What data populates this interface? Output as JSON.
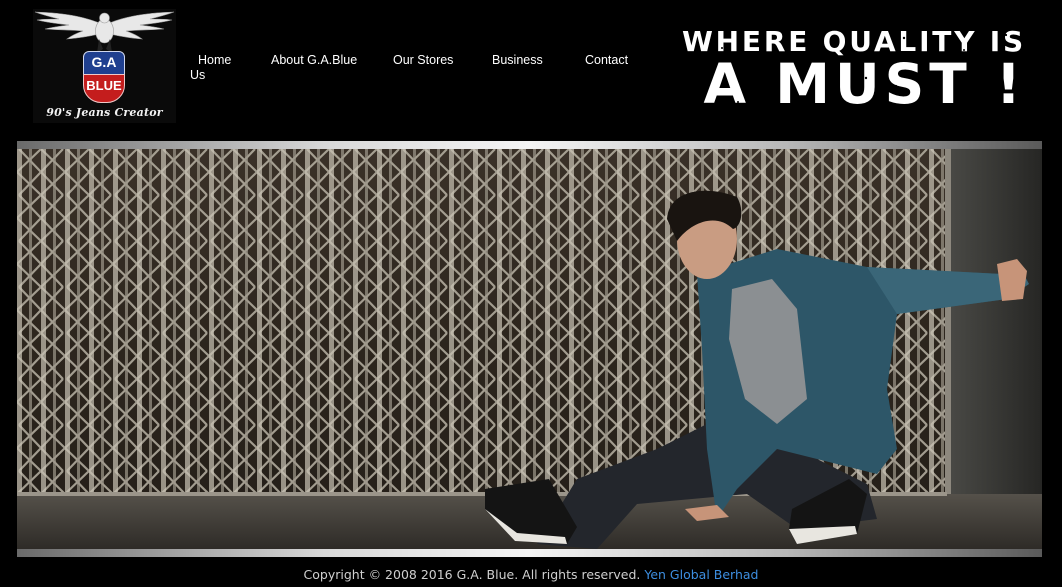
{
  "logo": {
    "badge_top": "G.A",
    "badge_bottom": "BLUE",
    "tagline": "90's Jeans Creator"
  },
  "nav": {
    "items": [
      {
        "label": "Home"
      },
      {
        "label": "About G.A.Blue"
      },
      {
        "label": "Our Stores"
      },
      {
        "label": "Business"
      },
      {
        "label": "Contact"
      }
    ],
    "contact_wrap": "Us"
  },
  "slogan": {
    "line1": "WHERE QUALITY IS",
    "line2": "A MUST !"
  },
  "banner": {
    "image": "model-crouching-in-front-of-metal-gate"
  },
  "footer": {
    "copyright": "Copyright © 2008 2016 G.A. Blue. All rights reserved.",
    "company_link": "Yen Global Berhad"
  },
  "colors": {
    "background": "#000000",
    "link": "#3d8ee0",
    "badge_blue": "#1f3f8f",
    "badge_red": "#c41d1d"
  }
}
